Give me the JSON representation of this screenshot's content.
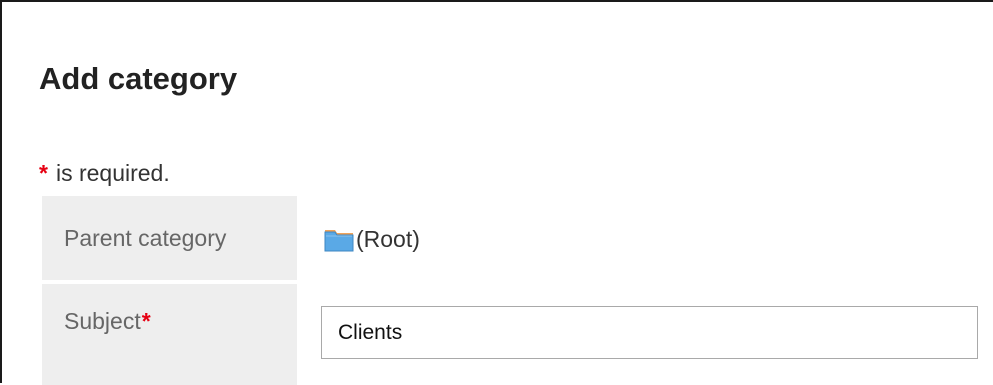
{
  "page": {
    "title": "Add category"
  },
  "required_note": {
    "asterisk": "*",
    "text": "is required."
  },
  "form": {
    "parent_category": {
      "label": "Parent category",
      "icon": "folder-icon",
      "value": "(Root)"
    },
    "subject": {
      "label": "Subject",
      "required_mark": "*",
      "value": "Clients",
      "placeholder": ""
    }
  },
  "colors": {
    "required_asterisk": "#e60012",
    "label_background": "#eeeeee",
    "folder_tab": "#f0a35a",
    "folder_body": "#5aa9e6"
  }
}
